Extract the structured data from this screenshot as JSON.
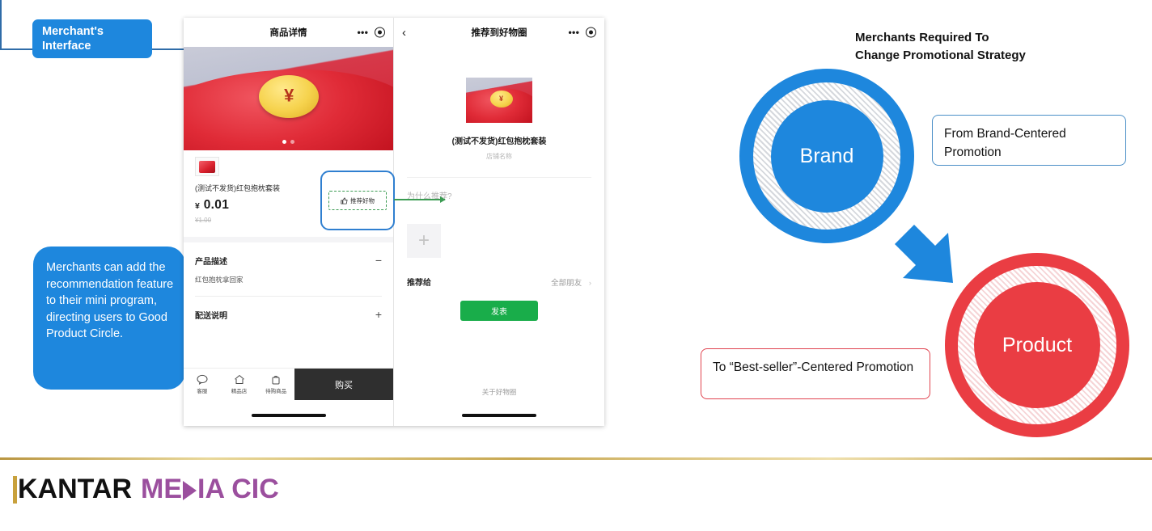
{
  "left_panel": {
    "badge": "Merchant's\nInterface",
    "callout": "Merchants can add the recommendation feature to their mini program, directing users to Good Product Circle.",
    "accent_color": "#1e87dd"
  },
  "phone_left": {
    "nav_title": "商品详情",
    "more_icon": "more-dots-icon",
    "capsule_icon": "target-icon",
    "product_name": "(测试不发货)红包抱枕套装",
    "price_symbol": "¥",
    "price": "0.01",
    "old_price": "¥1.00",
    "sections": [
      {
        "title": "产品描述",
        "sign": "−",
        "body": "红包抱枕拿回家"
      },
      {
        "title": "配送说明",
        "sign": "+",
        "body": ""
      }
    ],
    "tabs": [
      {
        "label": "客服",
        "icon": "chat-icon"
      },
      {
        "label": "精品店",
        "icon": "home-icon"
      },
      {
        "label": "待购商品",
        "icon": "bag-icon"
      }
    ],
    "buy_button": "购买"
  },
  "highlight": {
    "button_label": "推荐好物",
    "icon": "thumbs-up-icon",
    "box_color": "#2f7fd0",
    "dash_color": "#3c9b53"
  },
  "phone_right": {
    "nav_back": "‹",
    "nav_title": "推荐到好物圈",
    "product_title": "(测试不发货)红包抱枕套装",
    "shop_name": "店铺名称",
    "reason_placeholder": "为什么推荐?",
    "add_photo": "+",
    "recommend_to_label": "推荐给",
    "recommend_to_value": "全部朋友",
    "recommend_to_chevron": "›",
    "publish_button": "发表",
    "about_link": "关于好物圈"
  },
  "right_panel": {
    "title": "Merchants Required To\nChange Promotional Strategy",
    "circle_brand": "Brand",
    "circle_product": "Product",
    "box_from": "From Brand-Centered Promotion",
    "box_to": "To “Best-seller”-Centered Promotion",
    "brand_color": "#1e87dd",
    "product_color": "#ea3d43"
  },
  "footer": {
    "logo_part1": "KANTAR",
    "logo_part2a": "ME",
    "logo_part2b": "IA CIC",
    "gold_accent": "#c8a13c",
    "purple": "#9b4f9e"
  }
}
